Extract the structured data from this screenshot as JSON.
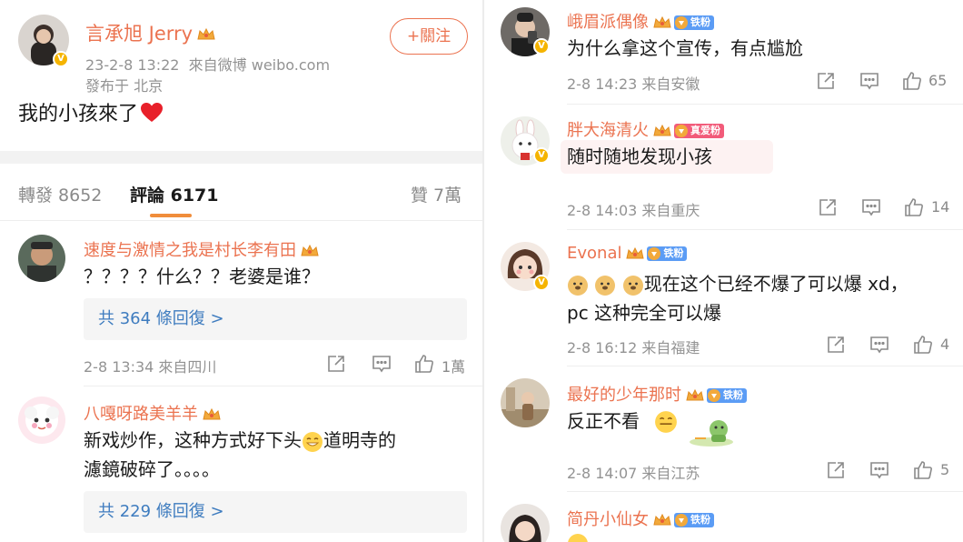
{
  "post": {
    "author": "言承旭 Jerry",
    "timestamp": "23-2-8 13:22",
    "source": "來自微博 weibo.com",
    "location": "發布于 北京",
    "text": "我的小孩來了",
    "follow_label": "+關注"
  },
  "tabs": {
    "repost": "轉發 8652",
    "comments": "評論 6171",
    "likes": "贊 7萬"
  },
  "left_comments": [
    {
      "user": "速度与激情之我是村长李有田",
      "text": "？？？？什么？？老婆是谁？",
      "replies": "共 364 條回復 >",
      "meta": "2-8 13:34  來自四川",
      "likes": "1萬"
    },
    {
      "user": "八嘎呀路美羊羊",
      "text_line1_a": "新戏炒作，这种方式好下头",
      "text_line1_b": "道明寺的",
      "text_line2": "濾鏡破碎了。。。。",
      "replies": "共 229 條回復 >"
    }
  ],
  "right_comments": [
    {
      "user": "峨眉派偶像",
      "badge": "铁粉",
      "text": "为什么拿这个宣传，有点尴尬",
      "meta": "2-8 14:23  来自安徽",
      "likes": "65"
    },
    {
      "user": "胖大海清火",
      "badge": "真爱粉",
      "text": "随时随地发现小孩",
      "meta": "2-8 14:03  来自重庆",
      "likes": "14"
    },
    {
      "user": "Evonal",
      "badge": "铁粉",
      "text_line1": "现在这个已经不爆了可以爆 xd，",
      "text_line2": "pc 这种完全可以爆",
      "meta": "2-8 16:12  来自福建",
      "likes": "4"
    },
    {
      "user": "最好的少年那时",
      "badge": "铁粉",
      "text": "反正不看",
      "meta": "2-8 14:07  来自江苏",
      "likes": "5"
    },
    {
      "user": "简丹小仙女",
      "badge": "铁粉"
    }
  ],
  "colors": {
    "username": "#eb7350",
    "reply_link": "#3e7cbf",
    "tab_underline": "#f08d3b",
    "meta_gray": "#939393"
  },
  "icons": [
    "vip-crown-icon",
    "verified-badge-icon",
    "share-icon",
    "comment-icon",
    "like-icon",
    "heart-emoji",
    "doge-emoji",
    "grin-emoji"
  ]
}
